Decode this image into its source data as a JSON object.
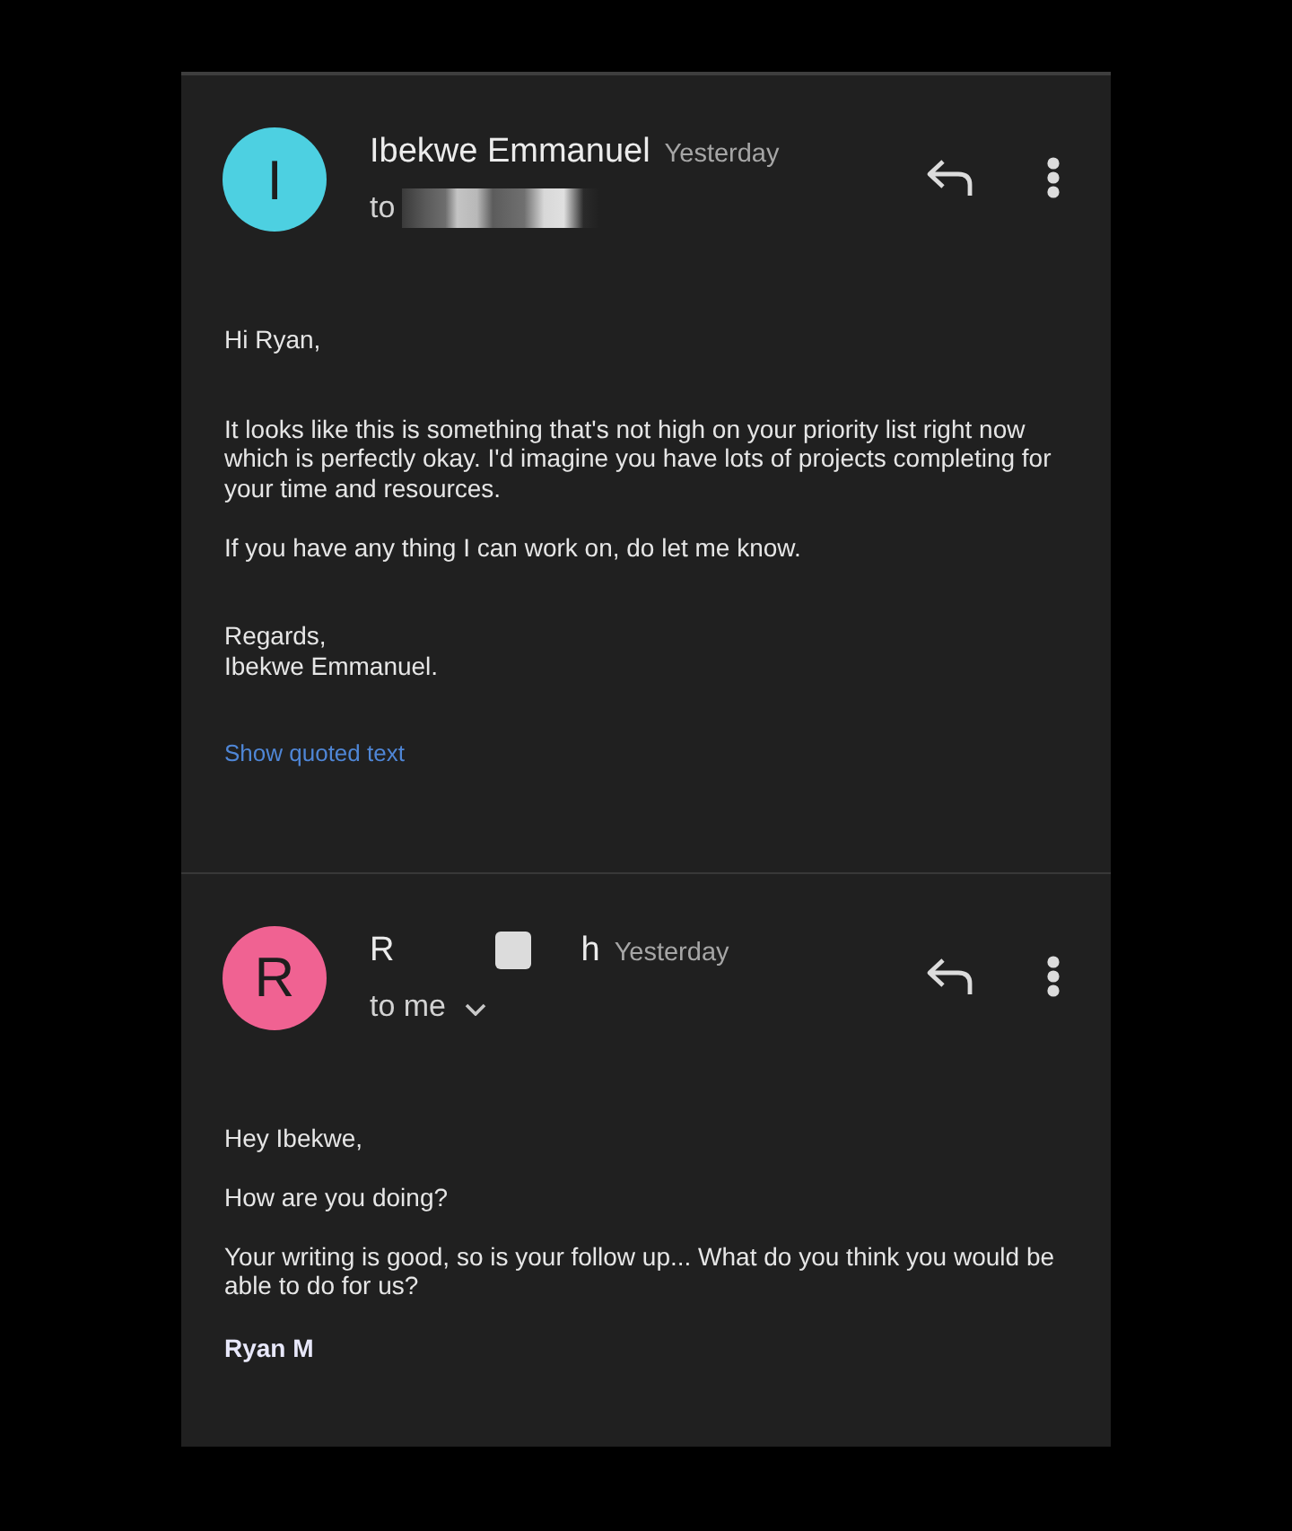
{
  "messages": [
    {
      "avatar": {
        "letter": "I",
        "color": "#4dd0e1"
      },
      "sender": {
        "parts": [
          "Ibekwe Emmanuel"
        ]
      },
      "time": "Yesterday",
      "recipient": {
        "text": "to",
        "redacted": true
      },
      "body": [
        {
          "paragraphs": [
            {
              "lines": [
                "Hi Ryan,"
              ]
            }
          ]
        },
        {
          "paragraphs": [
            {
              "lines": [
                "It looks like this is something that's not high on your priority list right now",
                "which is perfectly okay. I'd imagine you have lots of projects completing for",
                "your time and resources."
              ]
            },
            {
              "lines": [
                "If you have any thing I can work on, do let me know."
              ]
            }
          ]
        },
        {
          "paragraphs": [
            {
              "lines": [
                "Regards,",
                "Ibekwe Emmanuel."
              ]
            }
          ]
        }
      ],
      "quoted_text_link": "Show quoted text"
    },
    {
      "avatar": {
        "letter": "R",
        "color": "#f06292"
      },
      "sender": {
        "parts": [
          "R",
          "h"
        ]
      },
      "time": "Yesterday",
      "recipient": {
        "text": "to me",
        "caret": true
      },
      "body": [
        {
          "paragraphs": [
            {
              "lines": [
                "Hey Ibekwe,"
              ]
            },
            {
              "lines": [
                "How are you doing?"
              ]
            },
            {
              "lines": [
                "Your writing is good, so is your follow up... What do you think you would be",
                "able to do for us?"
              ]
            }
          ]
        }
      ],
      "signature": "Ryan M"
    }
  ]
}
